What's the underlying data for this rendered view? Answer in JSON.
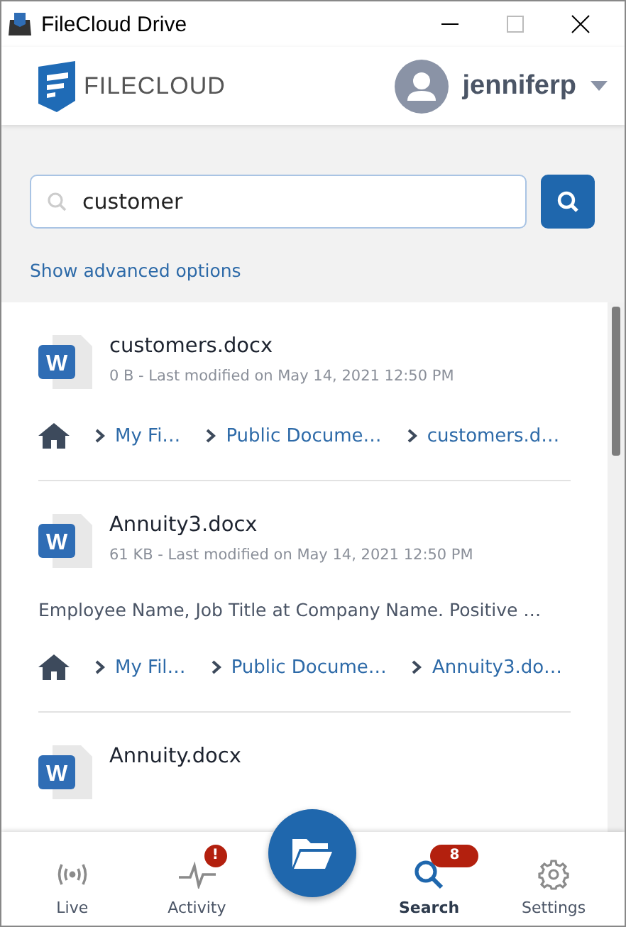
{
  "window": {
    "title": "FileCloud Drive"
  },
  "header": {
    "logo_text": "FILECLOUD",
    "username": "jenniferp"
  },
  "search": {
    "value": "customer",
    "advanced_link": "Show advanced options"
  },
  "results": [
    {
      "icon": "W",
      "name": "customers.docx",
      "meta": "0 B - Last modified on May 14, 2021 12:50 PM",
      "path": [
        "My Fi…",
        "Public Docume…",
        "customers.d…"
      ]
    },
    {
      "icon": "W",
      "name": "Annuity3.docx",
      "meta": "61 KB - Last modified on May 14, 2021 12:50 PM",
      "snippet": "Employee Name, Job Title at Company Name. Positive …",
      "path": [
        "My Fil…",
        "Public Docume…",
        "Annuity3.do…"
      ]
    },
    {
      "icon": "W",
      "name": "Annuity.docx"
    }
  ],
  "nav": [
    {
      "kind": "live",
      "label": "Live",
      "selected": false
    },
    {
      "kind": "activity",
      "label": "Activity",
      "selected": false,
      "badge": "!"
    },
    {
      "kind": "files",
      "selected": false
    },
    {
      "kind": "search",
      "label": "Search",
      "selected": true,
      "badge": "8"
    },
    {
      "kind": "settings",
      "label": "Settings",
      "selected": false
    }
  ]
}
